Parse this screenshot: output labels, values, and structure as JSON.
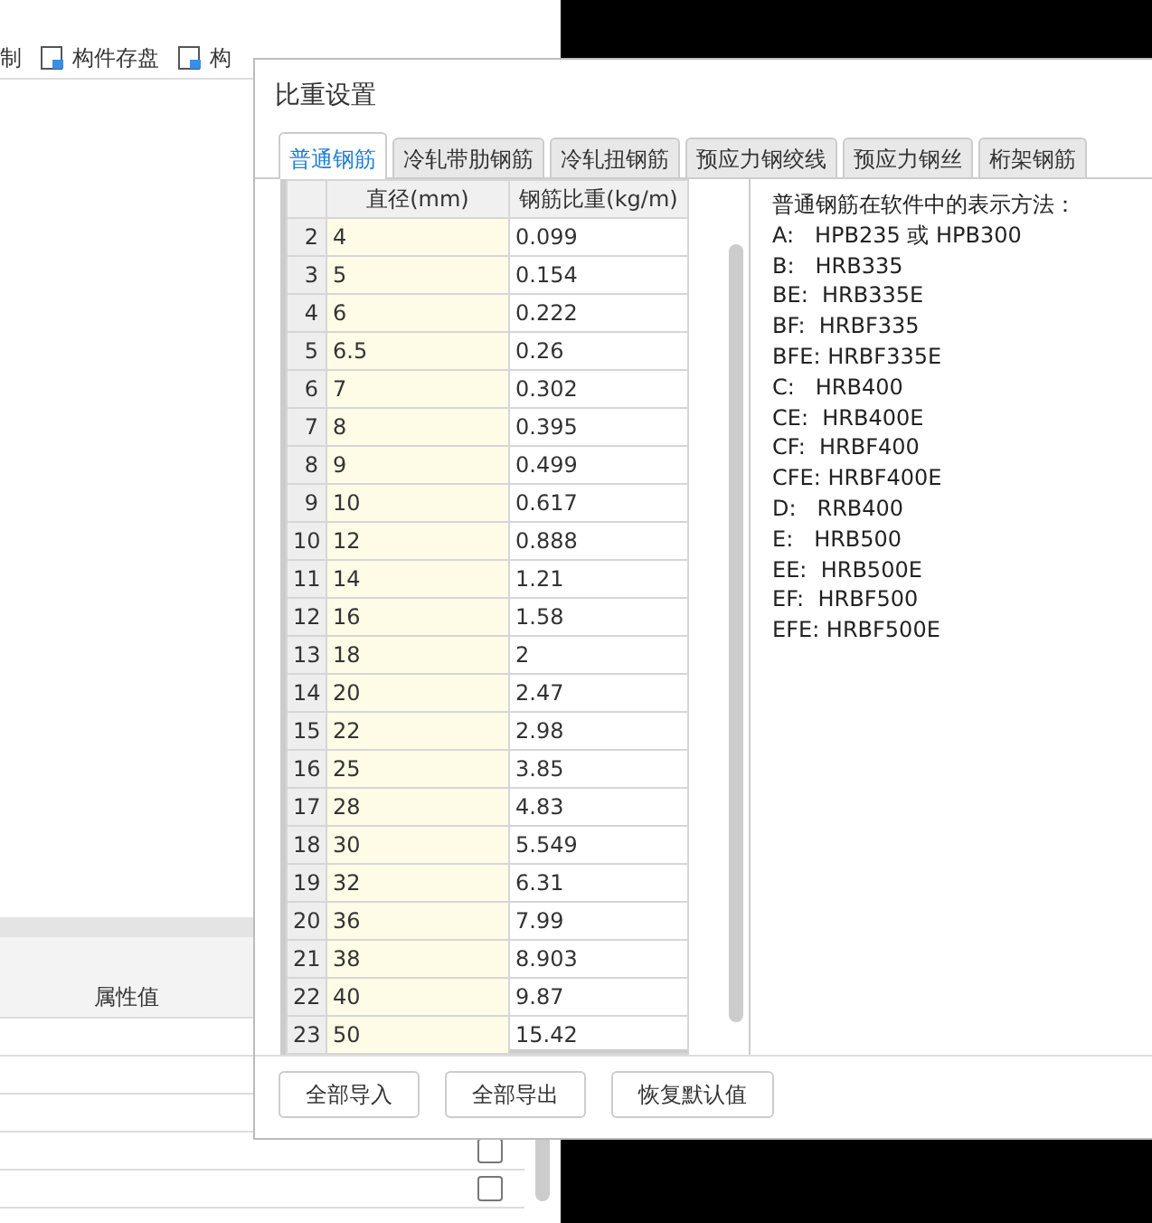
{
  "toolbar": [
    {
      "label": "制"
    },
    {
      "label": "构件存盘"
    },
    {
      "label": "构"
    }
  ],
  "property_panel": {
    "header": "属性值",
    "checkboxes": [
      {
        "checked": false
      },
      {
        "checked": false
      }
    ]
  },
  "dialog": {
    "title": "比重设置",
    "tabs": [
      {
        "label": "普通钢筋",
        "selected": true
      },
      {
        "label": "冷轧带肋钢筋",
        "selected": false
      },
      {
        "label": "冷轧扭钢筋",
        "selected": false
      },
      {
        "label": "预应力钢绞线",
        "selected": false
      },
      {
        "label": "预应力钢丝",
        "selected": false
      },
      {
        "label": "桁架钢筋",
        "selected": false
      }
    ],
    "table": {
      "columns": [
        "直径(mm)",
        "钢筋比重(kg/m)"
      ],
      "rows": [
        {
          "index": "2",
          "diameter": "4",
          "weight": "0.099"
        },
        {
          "index": "3",
          "diameter": "5",
          "weight": "0.154"
        },
        {
          "index": "4",
          "diameter": "6",
          "weight": "0.222"
        },
        {
          "index": "5",
          "diameter": "6.5",
          "weight": "0.26"
        },
        {
          "index": "6",
          "diameter": "7",
          "weight": "0.302"
        },
        {
          "index": "7",
          "diameter": "8",
          "weight": "0.395"
        },
        {
          "index": "8",
          "diameter": "9",
          "weight": "0.499"
        },
        {
          "index": "9",
          "diameter": "10",
          "weight": "0.617"
        },
        {
          "index": "10",
          "diameter": "12",
          "weight": "0.888"
        },
        {
          "index": "11",
          "diameter": "14",
          "weight": "1.21"
        },
        {
          "index": "12",
          "diameter": "16",
          "weight": "1.58"
        },
        {
          "index": "13",
          "diameter": "18",
          "weight": "2"
        },
        {
          "index": "14",
          "diameter": "20",
          "weight": "2.47"
        },
        {
          "index": "15",
          "diameter": "22",
          "weight": "2.98"
        },
        {
          "index": "16",
          "diameter": "25",
          "weight": "3.85"
        },
        {
          "index": "17",
          "diameter": "28",
          "weight": "4.83"
        },
        {
          "index": "18",
          "diameter": "30",
          "weight": "5.549"
        },
        {
          "index": "19",
          "diameter": "32",
          "weight": "6.31"
        },
        {
          "index": "20",
          "diameter": "36",
          "weight": "7.99"
        },
        {
          "index": "21",
          "diameter": "38",
          "weight": "8.903"
        },
        {
          "index": "22",
          "diameter": "40",
          "weight": "9.87"
        },
        {
          "index": "23",
          "diameter": "50",
          "weight": "15.42"
        }
      ]
    },
    "legend": {
      "title": "普通钢筋在软件中的表示方法：",
      "lines": [
        "A:   HPB235 或 HPB300",
        "B:   HRB335",
        "BE:  HRB335E",
        "BF:  HRBF335",
        "BFE: HRBF335E",
        "C:   HRB400",
        "CE:  HRB400E",
        "CF:  HRBF400",
        "CFE: HRBF400E",
        "D:   RRB400",
        "E:   HRB500",
        "EE:  HRB500E",
        "EF:  HRBF500",
        "EFE: HRBF500E"
      ]
    },
    "buttons": [
      "全部导入",
      "全部导出",
      "恢复默认值"
    ]
  }
}
